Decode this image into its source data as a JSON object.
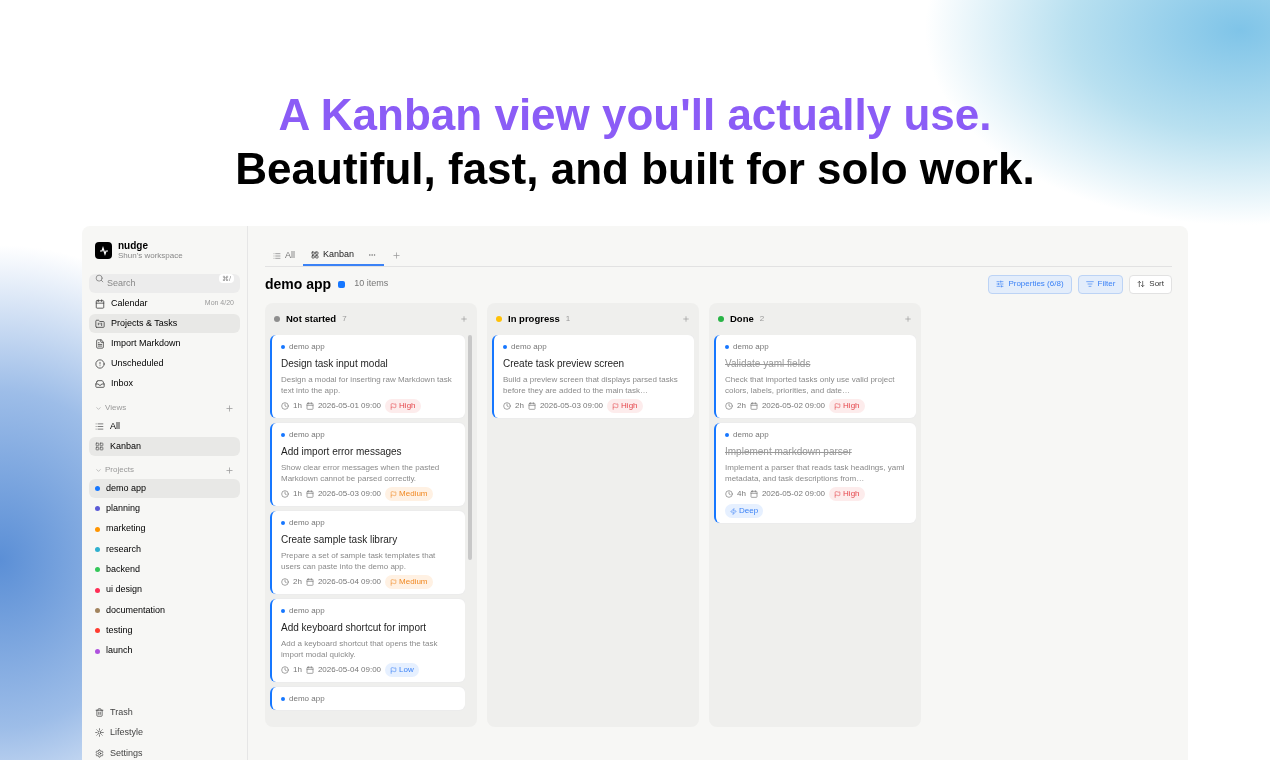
{
  "hero": {
    "headline": "A Kanban view you'll actually use.",
    "subheadline": "Beautiful, fast, and built for solo work."
  },
  "sidebar": {
    "app_name": "nudge",
    "workspace": "Shun's workspace",
    "search": {
      "placeholder": "Search",
      "shortcut": "⌘/"
    },
    "nav": [
      {
        "label": "Calendar",
        "meta": "Mon 4/20",
        "selected": false
      },
      {
        "label": "Projects & Tasks",
        "selected": true
      },
      {
        "label": "Import Markdown",
        "selected": false
      },
      {
        "label": "Unscheduled",
        "selected": false
      },
      {
        "label": "Inbox",
        "selected": false
      }
    ],
    "views_header": "Views",
    "views": [
      {
        "label": "All",
        "selected": false
      },
      {
        "label": "Kanban",
        "selected": true
      }
    ],
    "projects_header": "Projects",
    "projects": [
      {
        "label": "demo app",
        "color": "#1677ff",
        "selected": true
      },
      {
        "label": "planning",
        "color": "#5b5bd6",
        "selected": false
      },
      {
        "label": "marketing",
        "color": "#ff9500",
        "selected": false
      },
      {
        "label": "research",
        "color": "#2fb0cf",
        "selected": false
      },
      {
        "label": "backend",
        "color": "#34c759",
        "selected": false
      },
      {
        "label": "ui design",
        "color": "#ff2d55",
        "selected": false
      },
      {
        "label": "documentation",
        "color": "#a2845e",
        "selected": false
      },
      {
        "label": "testing",
        "color": "#ff3b30",
        "selected": false
      },
      {
        "label": "launch",
        "color": "#af52de",
        "selected": false
      }
    ],
    "footer": [
      {
        "label": "Trash"
      },
      {
        "label": "Lifestyle"
      },
      {
        "label": "Settings"
      }
    ]
  },
  "tabs": [
    {
      "label": "All",
      "selected": false
    },
    {
      "label": "Kanban",
      "selected": true
    }
  ],
  "board": {
    "title": "demo app",
    "color": "#1677ff",
    "count": "10 items",
    "buttons": [
      {
        "label": "Properties (6/8)",
        "active": true
      },
      {
        "label": "Filter",
        "active": true
      },
      {
        "label": "Sort",
        "active": false
      }
    ],
    "columns": [
      {
        "name": "Not started",
        "color": "#8e8e8e",
        "count": "7",
        "scrollbar": true,
        "cards": [
          {
            "project": "demo app",
            "title": "Design task input modal",
            "description": "Design a modal for inserting raw Markdown task text into the app.",
            "duration": "1h",
            "date": "2026-05-01 09:00",
            "priority": {
              "label": "High",
              "kind": "high"
            },
            "done": false
          },
          {
            "project": "demo app",
            "title": "Add import error messages",
            "description": "Show clear error messages when the pasted Markdown cannot be parsed correctly.",
            "duration": "1h",
            "date": "2026-05-03 09:00",
            "priority": {
              "label": "Medium",
              "kind": "medium"
            },
            "done": false
          },
          {
            "project": "demo app",
            "title": "Create sample task library",
            "description": "Prepare a set of sample task templates that users can paste into the demo app.",
            "duration": "2h",
            "date": "2026-05-04 09:00",
            "priority": {
              "label": "Medium",
              "kind": "medium"
            },
            "done": false
          },
          {
            "project": "demo app",
            "title": "Add keyboard shortcut for import",
            "description": "Add a keyboard shortcut that opens the task import modal quickly.",
            "duration": "1h",
            "date": "2026-05-04 09:00",
            "priority": {
              "label": "Low",
              "kind": "low"
            },
            "done": false
          },
          {
            "project": "demo app"
          }
        ]
      },
      {
        "name": "In progress",
        "color": "#ffc107",
        "count": "1",
        "scrollbar": false,
        "cards": [
          {
            "project": "demo app",
            "title": "Create task preview screen",
            "description": "Build a preview screen that displays parsed tasks before they are added to the main task…",
            "duration": "2h",
            "date": "2026-05-03 09:00",
            "priority": {
              "label": "High",
              "kind": "high"
            },
            "done": false
          }
        ]
      },
      {
        "name": "Done",
        "color": "#28b446",
        "count": "2",
        "scrollbar": false,
        "cards": [
          {
            "project": "demo app",
            "title": "Validate yaml fields",
            "description": "Check that imported tasks only use valid project colors, labels, priorities, and date…",
            "duration": "2h",
            "date": "2026-05-02 09:00",
            "priority": {
              "label": "High",
              "kind": "high"
            },
            "done": true
          },
          {
            "project": "demo app",
            "title": "Implement markdown parser",
            "description": "Implement a parser that reads task headings, yaml metadata, and task descriptions from…",
            "duration": "4h",
            "date": "2026-05-02 09:00",
            "priority": {
              "label": "High",
              "kind": "high"
            },
            "tags": [
              "Deep"
            ],
            "done": true
          }
        ]
      }
    ]
  }
}
